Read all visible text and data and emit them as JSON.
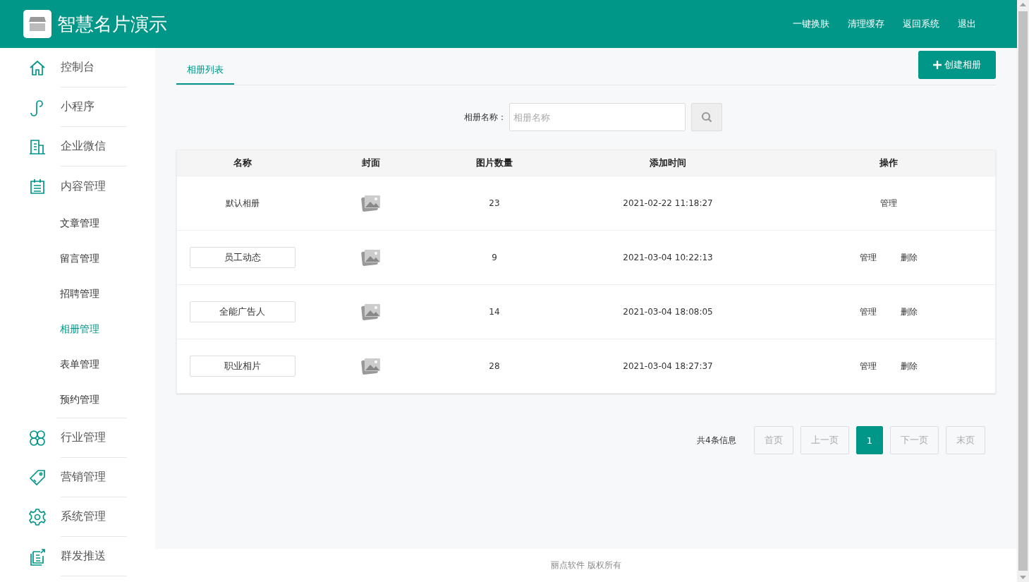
{
  "header": {
    "title": "智慧名片演示",
    "links": [
      "一键换肤",
      "清理缓存",
      "返回系统",
      "退出"
    ]
  },
  "sidebar": {
    "items": [
      {
        "label": "控制台",
        "expanded": false
      },
      {
        "label": "小程序",
        "expanded": false
      },
      {
        "label": "企业微信",
        "expanded": false
      },
      {
        "label": "内容管理",
        "expanded": true,
        "children": [
          {
            "label": "文章管理",
            "selected": false
          },
          {
            "label": "留言管理",
            "selected": false
          },
          {
            "label": "招聘管理",
            "selected": false
          },
          {
            "label": "相册管理",
            "selected": true
          },
          {
            "label": "表单管理",
            "selected": false
          },
          {
            "label": "预约管理",
            "selected": false
          }
        ]
      },
      {
        "label": "行业管理",
        "expanded": false
      },
      {
        "label": "营销管理",
        "expanded": false
      },
      {
        "label": "系统管理",
        "expanded": false
      },
      {
        "label": "群发推送",
        "expanded": false
      }
    ]
  },
  "tabs": [
    {
      "label": "相册列表",
      "selected": true
    }
  ],
  "create_button": "创建相册",
  "search": {
    "label": "相册名称：",
    "placeholder": "相册名称"
  },
  "table": {
    "columns": [
      "名称",
      "封面",
      "图片数量",
      "添加时间",
      "操作"
    ],
    "rows": [
      {
        "name": "默认相册",
        "kind": "text",
        "count": "23",
        "time": "2021-02-22 11:18:27",
        "actions": [
          "管理"
        ]
      },
      {
        "name": "员工动态",
        "kind": "input",
        "count": "9",
        "time": "2021-03-04 10:22:13",
        "actions": [
          "管理",
          "删除"
        ]
      },
      {
        "name": "全能广告人",
        "kind": "input",
        "count": "14",
        "time": "2021-03-04 18:08:05",
        "actions": [
          "管理",
          "删除"
        ]
      },
      {
        "name": "职业相片",
        "kind": "input",
        "count": "28",
        "time": "2021-03-04 18:27:37",
        "actions": [
          "管理",
          "删除"
        ]
      }
    ]
  },
  "pagination": {
    "info": "共4条信息",
    "items": [
      {
        "label": "首页",
        "kind": "nav",
        "disabled": true
      },
      {
        "label": "上一页",
        "kind": "nav",
        "disabled": true
      },
      {
        "label": "1",
        "kind": "page",
        "selected": true
      },
      {
        "label": "下一页",
        "kind": "nav",
        "disabled": true
      },
      {
        "label": "末页",
        "kind": "nav",
        "disabled": true
      }
    ]
  },
  "footer": "丽点软件 版权所有"
}
